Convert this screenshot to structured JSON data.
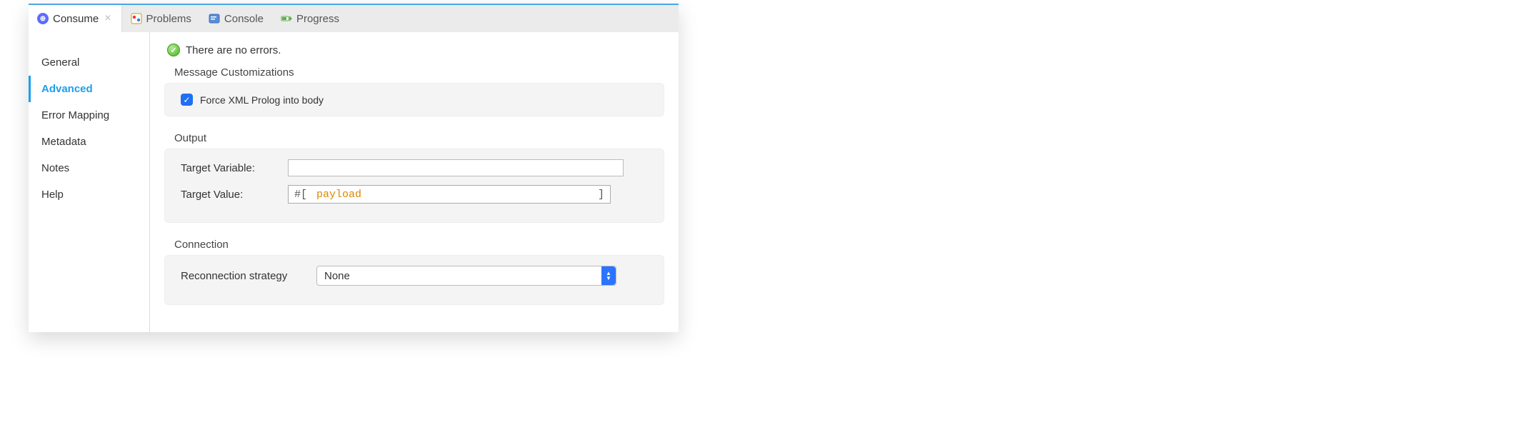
{
  "tabs": {
    "consume": {
      "label": "Consume"
    },
    "problems": {
      "label": "Problems"
    },
    "console": {
      "label": "Console"
    },
    "progress": {
      "label": "Progress"
    }
  },
  "sidebar": {
    "general": {
      "label": "General"
    },
    "advanced": {
      "label": "Advanced"
    },
    "errormapping": {
      "label": "Error Mapping"
    },
    "metadata": {
      "label": "Metadata"
    },
    "notes": {
      "label": "Notes"
    },
    "help": {
      "label": "Help"
    }
  },
  "status": {
    "message": "There are no errors."
  },
  "sections": {
    "messageCustomizations": {
      "title": "Message Customizations",
      "forceXml": {
        "label": "Force XML Prolog into body",
        "checked": true
      }
    },
    "output": {
      "title": "Output",
      "targetVariable": {
        "label": "Target Variable:",
        "value": ""
      },
      "targetValue": {
        "label": "Target Value:",
        "prefix": "#[",
        "payload": "payload",
        "suffix": "]"
      }
    },
    "connection": {
      "title": "Connection",
      "reconnection": {
        "label": "Reconnection strategy",
        "value": "None"
      }
    }
  }
}
